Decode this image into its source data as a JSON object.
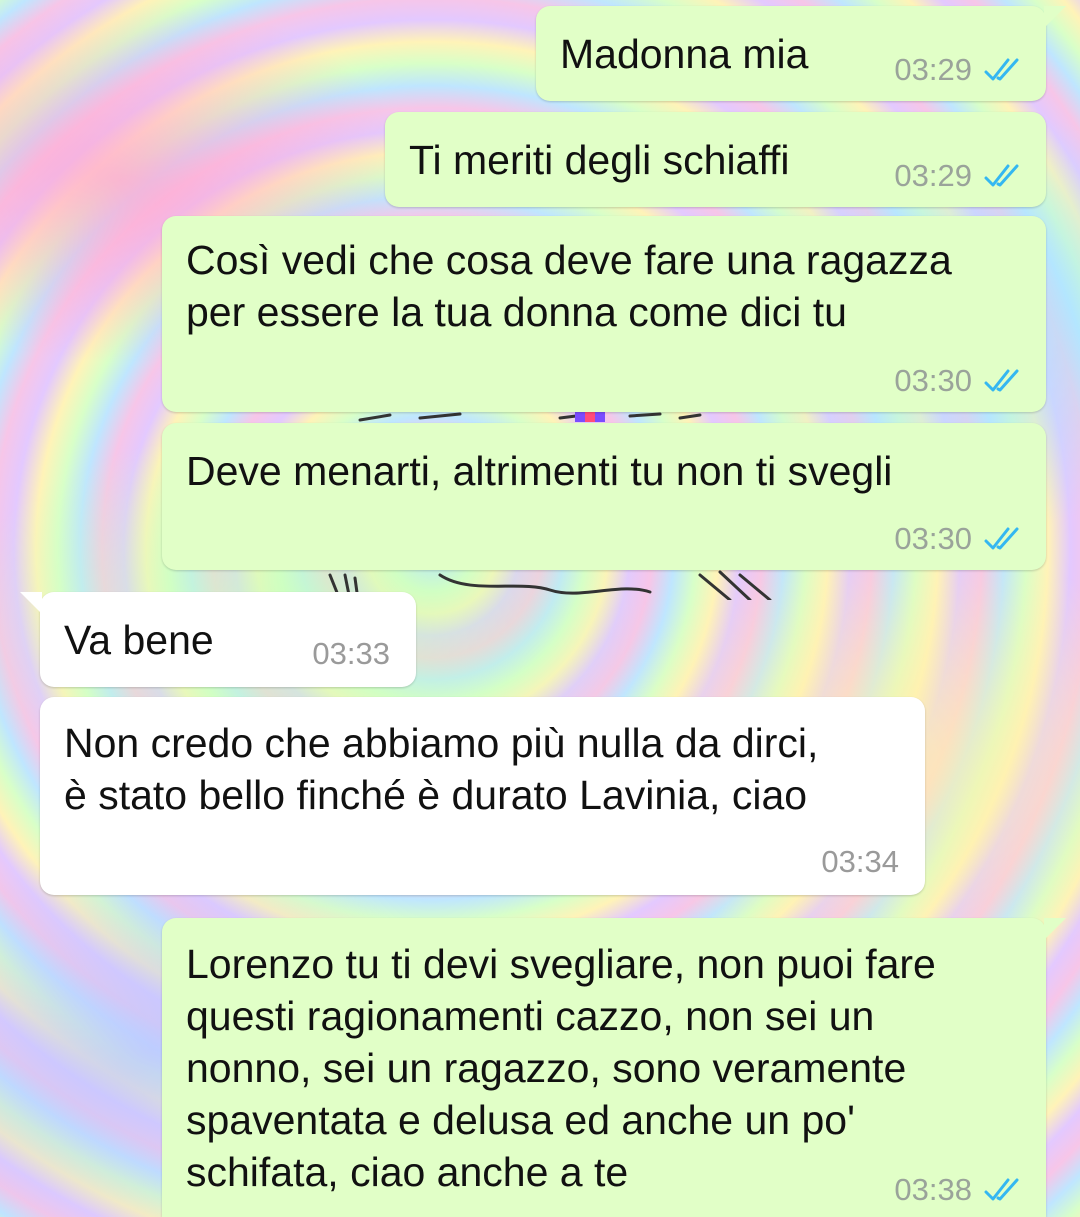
{
  "chat": {
    "messages": [
      {
        "direction": "outgoing",
        "text": "Madonna mia",
        "time": "03:29",
        "status": "read"
      },
      {
        "direction": "outgoing",
        "text": "Ti meriti degli schiaffi",
        "time": "03:29",
        "status": "read"
      },
      {
        "direction": "outgoing",
        "text": "Così vedi che cosa deve fare una ragazza\nper essere la tua donna come dici tu",
        "time": "03:30",
        "status": "read"
      },
      {
        "direction": "outgoing",
        "text": "Deve menarti, altrimenti tu non ti svegli",
        "time": "03:30",
        "status": "read"
      },
      {
        "direction": "incoming",
        "text": "Va bene",
        "time": "03:33"
      },
      {
        "direction": "incoming",
        "text": "Non credo che abbiamo più nulla da dirci,\nè stato bello finché è durato Lavinia, ciao",
        "time": "03:34"
      },
      {
        "direction": "outgoing",
        "text": "Lorenzo tu ti devi svegliare, non puoi fare\nquesti ragionamenti cazzo, non sei un\nnonno, sei un ragazzo, sono veramente\nspaventata e delusa ed anche un po'\nschifata, ciao anche a te",
        "time": "03:38",
        "status": "read"
      }
    ]
  },
  "colors": {
    "outgoing_bubble": "#e1ffc7",
    "incoming_bubble": "#ffffff",
    "read_ticks": "#34b7f1",
    "timestamp": "#9aa39a"
  },
  "icons": {
    "read_status": "double-check-icon",
    "background": "psychedelic-swirl-wallpaper"
  }
}
